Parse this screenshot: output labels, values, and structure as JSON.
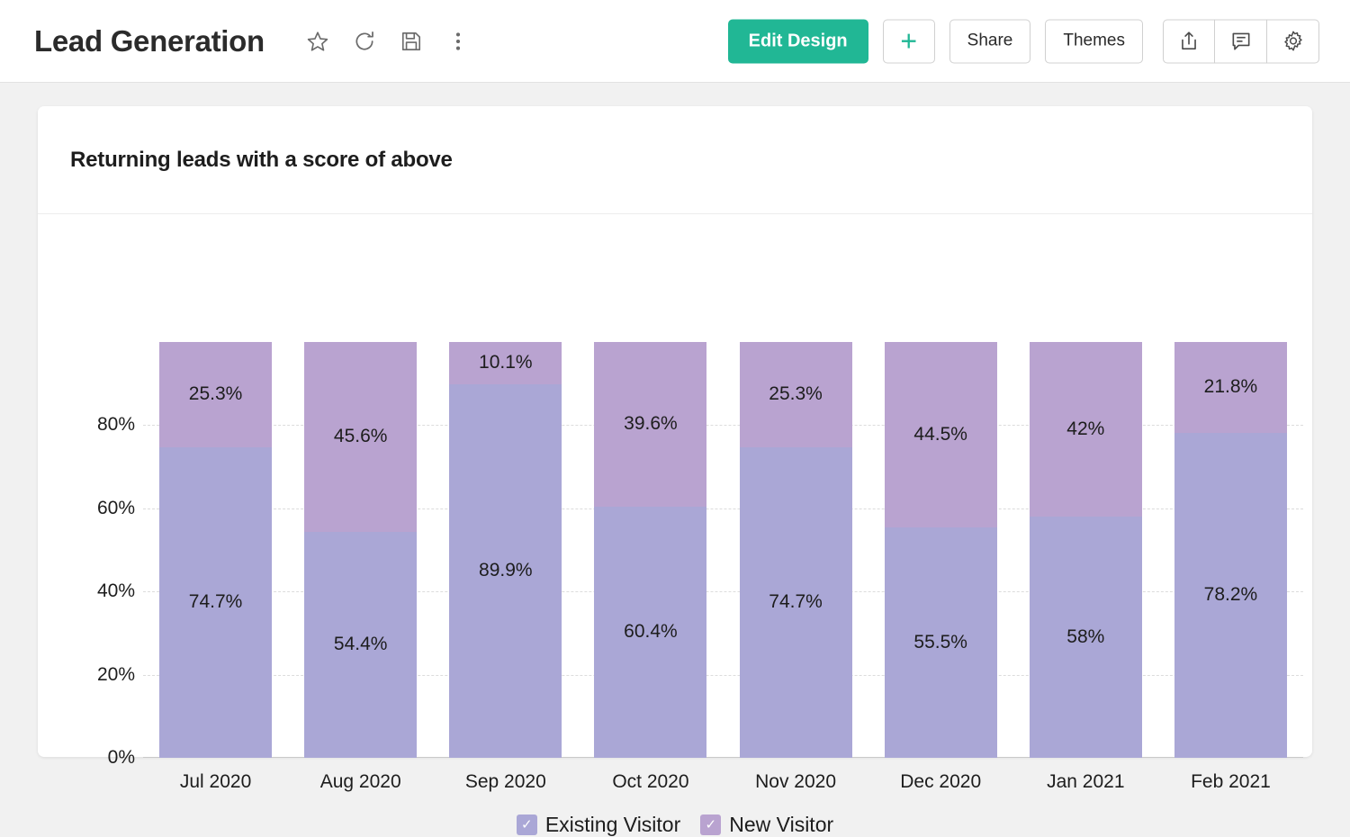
{
  "header": {
    "title": "Lead Generation",
    "icons": [
      {
        "name": "star-icon",
        "label": "Favorite"
      },
      {
        "name": "refresh-icon",
        "label": "Refresh"
      },
      {
        "name": "save-icon",
        "label": "Save"
      },
      {
        "name": "more-options-icon",
        "label": "More options"
      }
    ],
    "toolbar": {
      "edit_design_label": "Edit Design",
      "add_label": "+",
      "share_label": "Share",
      "themes_label": "Themes",
      "export_icon": "export-icon",
      "comment_icon": "comment-icon",
      "settings_icon": "gear-icon"
    }
  },
  "colors": {
    "accent_green": "#21b795",
    "existing_visitor": "#aaa7d6",
    "new_visitor": "#b9a3d0",
    "page_background": "#f1f1f1",
    "card_background": "#ffffff",
    "gridline": "#dcdcdc"
  },
  "card": {
    "title": "Returning leads with a score of above"
  },
  "chart_data": {
    "type": "bar",
    "stacked": true,
    "stack_mode": "percent",
    "title": "Returning leads with a score of above",
    "xlabel": "",
    "ylabel": "",
    "ylim": [
      0,
      100
    ],
    "yticks": [
      0,
      20,
      40,
      60,
      80
    ],
    "ytick_labels": [
      "0%",
      "20%",
      "40%",
      "60%",
      "80%"
    ],
    "grid": true,
    "legend_position": "bottom",
    "categories": [
      "Jul 2020",
      "Aug 2020",
      "Sep 2020",
      "Oct 2020",
      "Nov 2020",
      "Dec 2020",
      "Jan 2021",
      "Feb 2021"
    ],
    "series": [
      {
        "name": "Existing Visitor",
        "color": "#aaa7d6",
        "values": [
          74.7,
          54.4,
          89.9,
          60.4,
          74.7,
          55.5,
          58,
          78.2
        ],
        "labels": [
          "74.7%",
          "54.4%",
          "89.9%",
          "60.4%",
          "74.7%",
          "55.5%",
          "58%",
          "78.2%"
        ]
      },
      {
        "name": "New Visitor",
        "color": "#b9a3d0",
        "values": [
          25.3,
          45.6,
          10.1,
          39.6,
          25.3,
          44.5,
          42,
          21.8
        ],
        "labels": [
          "25.3%",
          "45.6%",
          "10.1%",
          "39.6%",
          "25.3%",
          "44.5%",
          "42%",
          "21.8%"
        ]
      }
    ]
  },
  "legend": [
    {
      "label": "Existing Visitor",
      "color": "#aaa7d6",
      "checked": true,
      "check_glyph": "✓"
    },
    {
      "label": "New Visitor",
      "color": "#b9a3d0",
      "checked": true,
      "check_glyph": "✓"
    }
  ]
}
